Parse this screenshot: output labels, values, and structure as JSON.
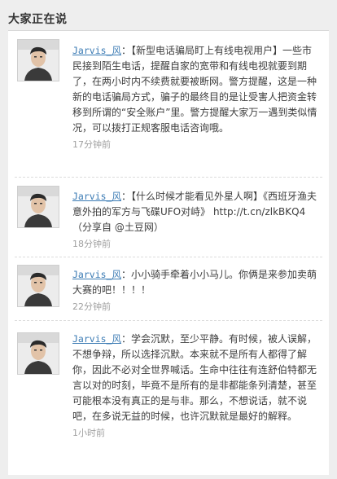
{
  "widget": {
    "title": "大家正在说"
  },
  "feed": [
    {
      "author": "Jarvis_风",
      "colon": "：",
      "text": "【新型电话骗局盯上有线电视用户】一些市民接到陌生电话，提醒自家的宽带和有线电视就要到期了，在两小时内不续费就要被断网。警方提醒，这是一种新的电话骗局方式，骗子的最终目的是让受害人把资金转移到所谓的“安全账户”里。警方提醒大家万一遇到类似情况，可以拨打正规客服电话咨询哦。",
      "time": "17分钟前"
    },
    {
      "author": "Jarvis_风",
      "colon": "：",
      "text": "【什么时候才能看见外星人啊】《西班牙渔夫意外拍的军方与飞碟UFO对峙》 http://t.cn/zlkBKQ4 （分享自 @土豆网）",
      "time": "18分钟前"
    },
    {
      "author": "Jarvis_风",
      "colon": "：",
      "text": "小小骑手牵着小小马儿。你俩是来参加卖萌大赛的吧！！！！",
      "time": "22分钟前"
    },
    {
      "author": "Jarvis_风",
      "colon": "：",
      "text": "学会沉默，至少平静。有时候，被人误解，不想争辩，所以选择沉默。本来就不是所有人都得了解你，因此不必对全世界喊话。生命中往往有连舒伯特都无言以对的时刻，毕竟不是所有的是非都能条列清楚，甚至可能根本没有真正的是与非。那么，不想说话，就不说吧，在多说无益的时候，也许沉默就是最好的解释。",
      "time": "1小时前"
    }
  ],
  "colors": {
    "link": "#3b7bb4",
    "text": "#3d3d3d",
    "muted": "#a0a0a0",
    "background": "#eeeeee"
  }
}
